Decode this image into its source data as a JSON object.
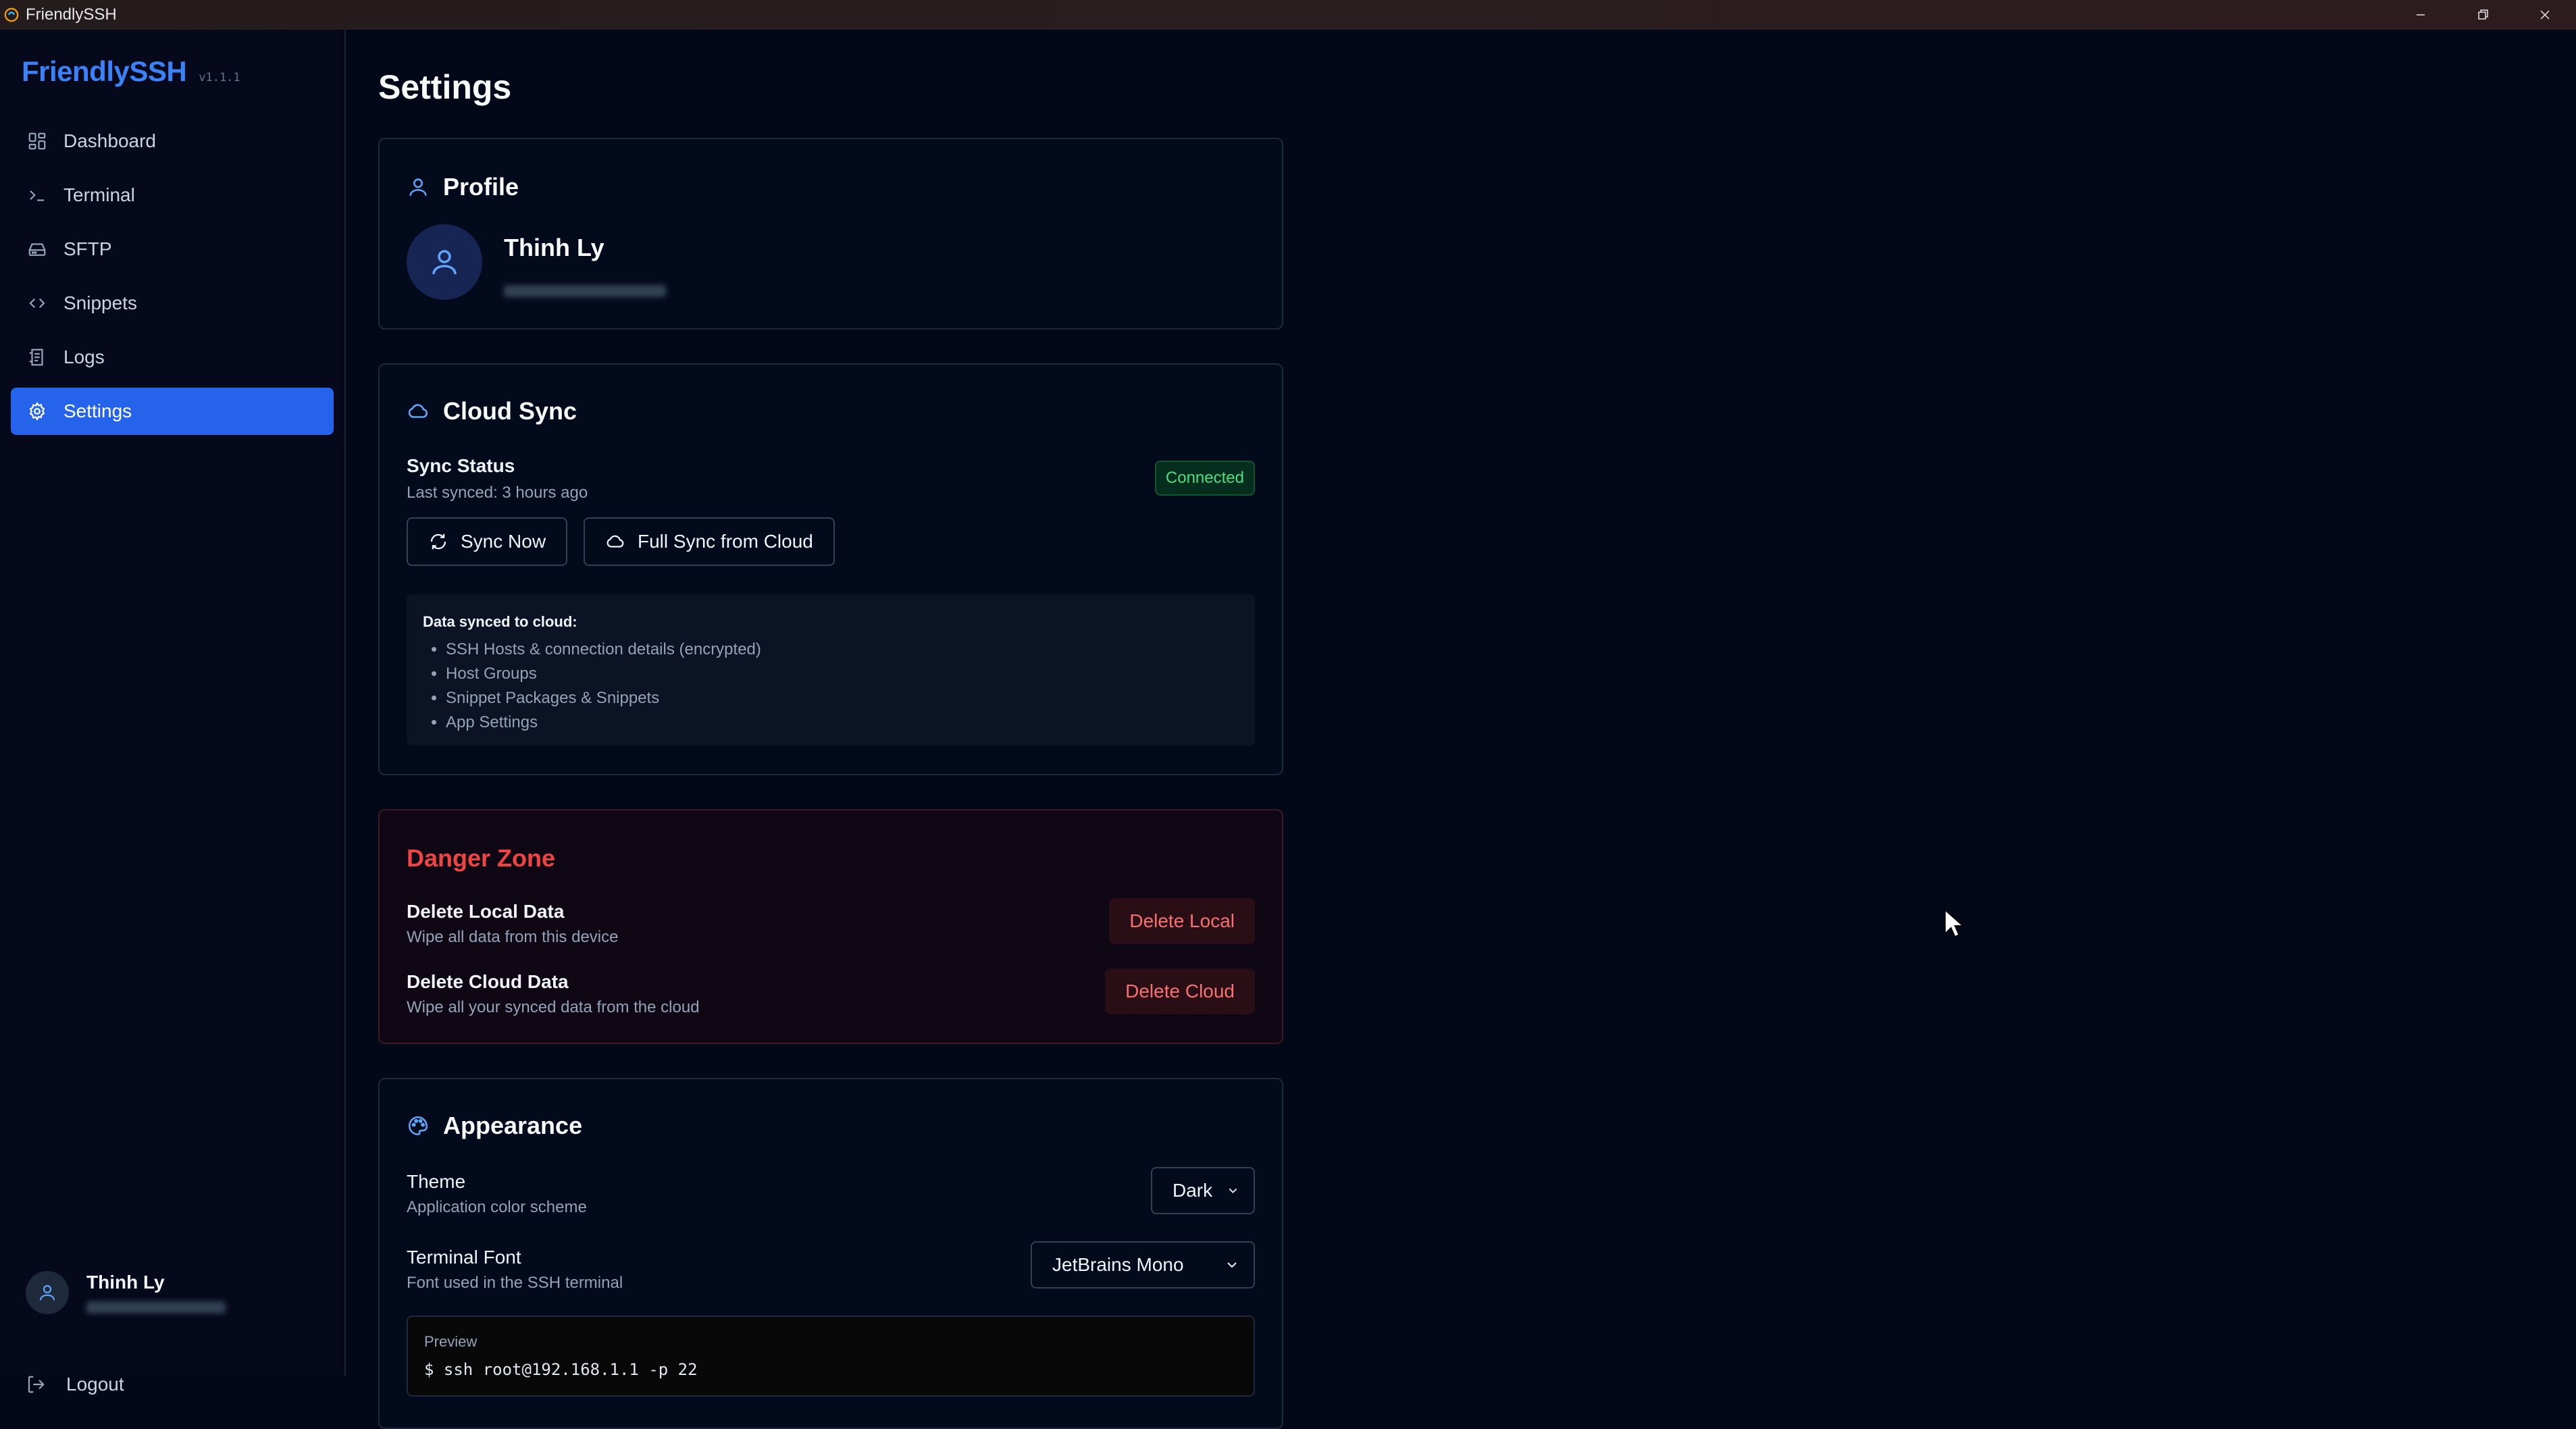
{
  "window": {
    "title": "FriendlySSH"
  },
  "sidebar": {
    "brand": "FriendlySSH",
    "version": "v1.1.1",
    "items": [
      {
        "label": "Dashboard",
        "icon": "dashboard-icon"
      },
      {
        "label": "Terminal",
        "icon": "terminal-icon"
      },
      {
        "label": "SFTP",
        "icon": "drive-icon"
      },
      {
        "label": "Snippets",
        "icon": "code-icon"
      },
      {
        "label": "Logs",
        "icon": "logs-icon"
      },
      {
        "label": "Settings",
        "icon": "gear-icon",
        "active": true
      }
    ],
    "user": {
      "name": "Thinh Ly"
    },
    "logout_label": "Logout"
  },
  "page": {
    "title": "Settings"
  },
  "profile": {
    "title": "Profile",
    "name": "Thinh Ly"
  },
  "cloud_sync": {
    "title": "Cloud Sync",
    "status_label": "Sync Status",
    "last_synced": "Last synced: 3 hours ago",
    "status_badge": "Connected",
    "sync_now_label": "Sync Now",
    "full_sync_label": "Full Sync from Cloud",
    "info_title": "Data synced to cloud:",
    "info_items": [
      "SSH Hosts & connection details (encrypted)",
      "Host Groups",
      "Snippet Packages & Snippets",
      "App Settings"
    ]
  },
  "danger_zone": {
    "title": "Danger Zone",
    "local": {
      "label": "Delete Local Data",
      "desc": "Wipe all data from this device",
      "button": "Delete Local"
    },
    "cloud": {
      "label": "Delete Cloud Data",
      "desc": "Wipe all your synced data from the cloud",
      "button": "Delete Cloud"
    }
  },
  "appearance": {
    "title": "Appearance",
    "theme": {
      "label": "Theme",
      "desc": "Application color scheme",
      "value": "Dark"
    },
    "font": {
      "label": "Terminal Font",
      "desc": "Font used in the SSH terminal",
      "value": "JetBrains Mono"
    },
    "preview_label": "Preview",
    "preview_code": "$ ssh root@192.168.1.1 -p 22"
  },
  "colors": {
    "accent": "#3b82f6",
    "active_nav": "#2563eb",
    "danger": "#ef4444",
    "success": "#4ade80",
    "background": "#020817"
  }
}
